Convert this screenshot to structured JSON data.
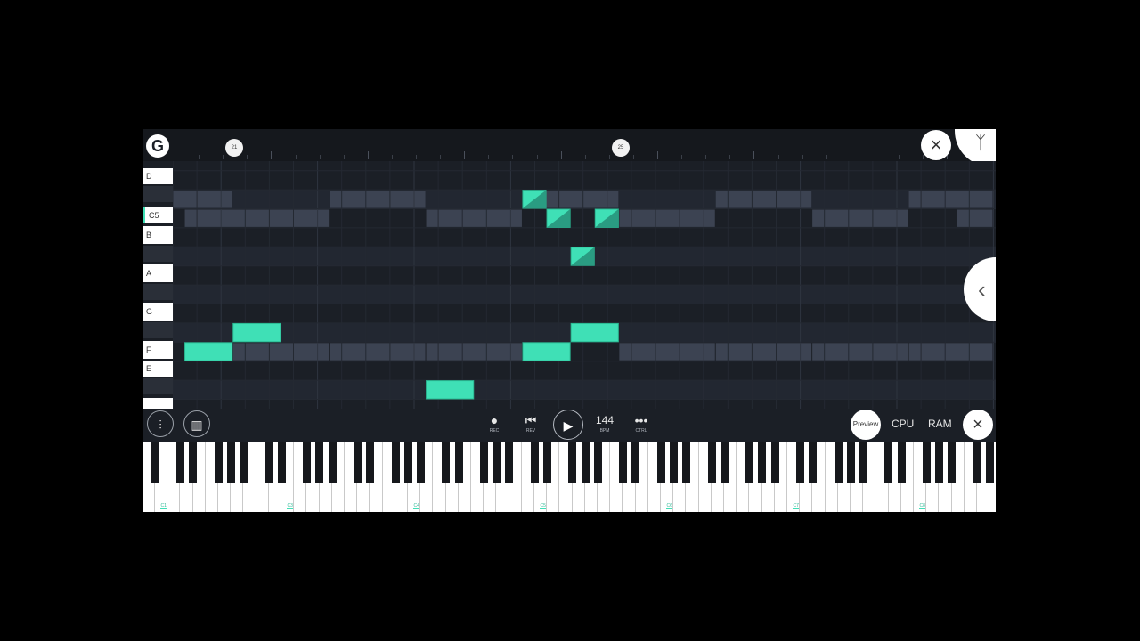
{
  "app": {
    "logo_text": "G"
  },
  "timeline": {
    "markers": [
      "21",
      "25"
    ]
  },
  "keys": [
    {
      "label": "D",
      "active": false
    },
    {
      "label": "C5",
      "active": true
    },
    {
      "label": "B",
      "active": false
    },
    {
      "label": "A",
      "active": false
    },
    {
      "label": "G",
      "active": false
    },
    {
      "label": "F",
      "active": false
    },
    {
      "label": "E",
      "active": false
    }
  ],
  "notes": [
    {
      "pitch": "F",
      "start_step": 0.5,
      "length_steps": 2,
      "triangle": false
    },
    {
      "pitch": "F#",
      "start_step": 2.5,
      "length_steps": 2,
      "triangle": false
    },
    {
      "pitch": "D#",
      "start_step": 10.5,
      "length_steps": 2,
      "triangle": false
    },
    {
      "pitch": "C#5",
      "start_step": 14.5,
      "length_steps": 1,
      "triangle": true
    },
    {
      "pitch": "C5",
      "start_step": 15.5,
      "length_steps": 1,
      "triangle": true
    },
    {
      "pitch": "C5",
      "start_step": 17.5,
      "length_steps": 1,
      "triangle": true
    },
    {
      "pitch": "A#",
      "start_step": 16.5,
      "length_steps": 1,
      "triangle": true
    },
    {
      "pitch": "F",
      "start_step": 14.5,
      "length_steps": 2,
      "triangle": false
    },
    {
      "pitch": "F#",
      "start_step": 16.5,
      "length_steps": 2,
      "triangle": false
    }
  ],
  "toolbar": {
    "rec_caption": "REC",
    "rev_caption": "REV",
    "bpm_value": "144",
    "bpm_caption": "BPM",
    "ctrl_caption": "CTRL",
    "preview_label": "Preview",
    "cpu_label": "CPU",
    "ram_label": "RAM"
  },
  "piano": {
    "octave_labels": [
      "C1",
      "C3",
      "C4",
      "C5",
      "C6",
      "C7",
      "C8"
    ]
  },
  "colors": {
    "note": "#3fe0b6",
    "grid_bg": "#1b1f26",
    "black_row": "#222731",
    "bar_band": "#3c4352"
  }
}
